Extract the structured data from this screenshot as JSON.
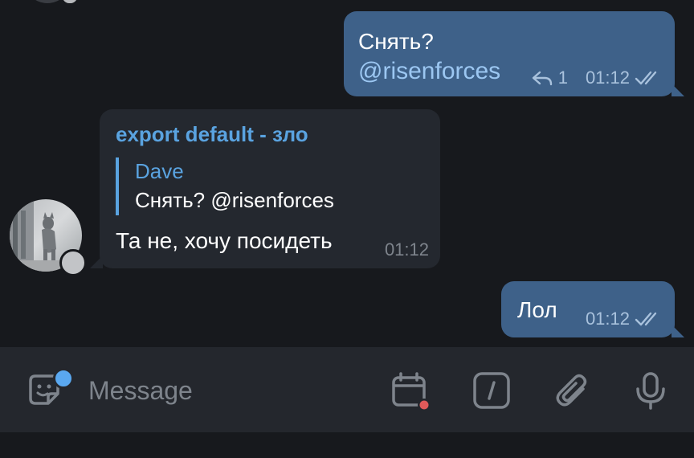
{
  "messages": [
    {
      "direction": "outgoing",
      "line1": "Снять?",
      "line2": "@risenforces",
      "reply_count": "1",
      "time": "01:12"
    },
    {
      "direction": "incoming",
      "sender": "export default - зло",
      "quote_author": "Dave",
      "quote_text": "Снять? @risenforces",
      "text": "Та не, хочу посидеть",
      "time": "01:12"
    },
    {
      "direction": "outgoing",
      "text": "Лол",
      "time": "01:12"
    }
  ],
  "composer": {
    "placeholder": "Message",
    "icons": [
      "sticker-icon",
      "schedule-calendar-icon",
      "bot-commands-icon",
      "attach-icon",
      "microphone-icon"
    ]
  },
  "colors": {
    "background": "#17191d",
    "outgoing_bubble": "#3e6189",
    "incoming_bubble": "#24282f",
    "accent": "#5aa3e0",
    "input_bar": "#24272d"
  }
}
